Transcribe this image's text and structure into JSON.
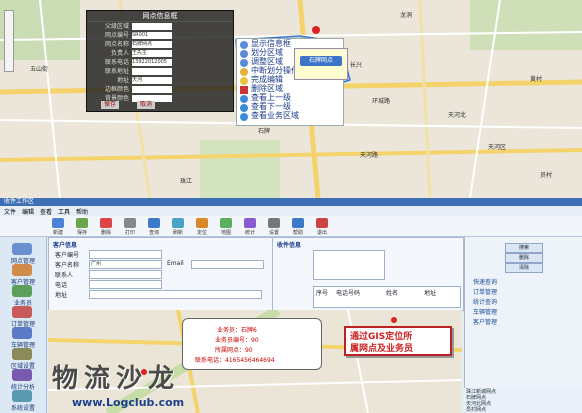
{
  "map": {
    "labels": [
      "五山街",
      "环城路",
      "天河区",
      "天河北",
      "天河路",
      "黄村",
      "员村",
      "珠江",
      "石牌",
      "龙洞",
      "长兴"
    ]
  },
  "info_panel": {
    "title": "网点信息框",
    "rows": [
      {
        "label": "父级区域",
        "value": ""
      },
      {
        "label": "网点编号",
        "value": "SR001"
      },
      {
        "label": "网点名称",
        "value": "石牌网点"
      },
      {
        "label": "负责人",
        "value": "王先生"
      },
      {
        "label": "联系电话",
        "value": "13922012005"
      },
      {
        "label": "联系地址",
        "value": ""
      },
      {
        "label": "地址",
        "value": "天河"
      },
      {
        "label": "边框颜色",
        "value": ""
      },
      {
        "label": "背景颜色",
        "value": ""
      }
    ],
    "save_label": "保存",
    "cancel_label": "取消"
  },
  "context_menu": {
    "items": [
      "显示信息框",
      "划分区域",
      "调整区域",
      "中断划分操作",
      "完成编辑",
      "删除区域",
      "查看上一级",
      "查看下一级",
      "查看业务区域"
    ],
    "popup_button": "石牌网点"
  },
  "app": {
    "window_title": "收件工作区",
    "menu": [
      "文件",
      "编辑",
      "查看",
      "工具",
      "帮助"
    ],
    "toolbar": [
      "新建",
      "保存",
      "删除",
      "打印",
      "查询",
      "刷新",
      "定位",
      "地图",
      "统计",
      "设置",
      "帮助",
      "退出"
    ],
    "left_nav": [
      "网点管理",
      "客户管理",
      "业务员",
      "订单管理",
      "车辆管理",
      "区域设置",
      "统计分析",
      "系统设置"
    ],
    "form": {
      "title": "客户信息",
      "fields": [
        {
          "label": "客户编号",
          "value": ""
        },
        {
          "label": "客户名称",
          "value": "广州"
        },
        {
          "label": "联系人",
          "value": ""
        },
        {
          "label": "电话",
          "value": ""
        },
        {
          "label": "地址",
          "value": ""
        },
        {
          "label": "Email",
          "value": ""
        }
      ]
    },
    "right_panel": {
      "title": "收件信息",
      "table_headers": [
        "序号",
        "电话号码",
        "姓名",
        "地址"
      ]
    },
    "far_right": {
      "buttons": [
        "搜索",
        "删除",
        "清除"
      ],
      "links": [
        "快速查询",
        "订单管理",
        "统计查询",
        "车辆管理",
        "客户管理"
      ],
      "list": [
        "珠江新城网点",
        "石牌网点",
        "天河北网点",
        "员村网点"
      ]
    },
    "sales_popup": {
      "lines": [
        "业务员：石牌6",
        "业务员编号：90",
        "所属网点：90",
        "联系电话：4165456464694"
      ]
    },
    "annotation": [
      "通过GIS定位所",
      "属网点及业务员"
    ],
    "watermark": "物流沙龙",
    "watermark_url": "www.Logclub.com"
  },
  "colors": {
    "accent": "#3d6fb4",
    "annotation": "#c22222",
    "map_road": "#f5d36b"
  }
}
